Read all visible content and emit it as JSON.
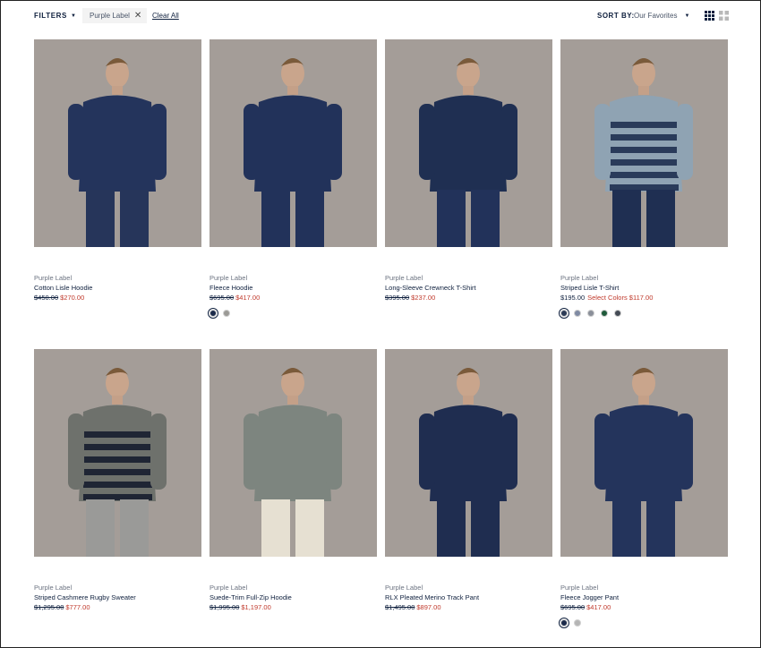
{
  "toolbar": {
    "filters_label": "FILTERS",
    "active_filter": "Purple Label",
    "clear_all": "Clear All",
    "sort_label": "SORT BY:",
    "sort_value": "Our Favorites"
  },
  "colors": {
    "navy": "#0e1f3d",
    "sale_red": "#c0392b",
    "photo_bg": "#a49d98"
  },
  "products": [
    {
      "brand": "Purple Label",
      "name": "Cotton Lisle Hoodie",
      "original_price": "$450.00",
      "sale_price": "$270.00",
      "swatches": []
    },
    {
      "brand": "Purple Label",
      "name": "Fleece Hoodie",
      "original_price": "$695.00",
      "sale_price": "$417.00",
      "swatches": [
        "#1b2a4a",
        "#9b9a96"
      ]
    },
    {
      "brand": "Purple Label",
      "name": "Long-Sleeve Crewneck T-Shirt",
      "original_price": "$395.00",
      "sale_price": "$237.00",
      "swatches": []
    },
    {
      "brand": "Purple Label",
      "name": "Striped Lisle T-Shirt",
      "price": "$195.00",
      "sale_price": "Select Colors $117.00",
      "swatches": [
        "#2b3a55",
        "#7f8aa3",
        "#8a8f99",
        "#1f5a3a",
        "#444b55"
      ]
    },
    {
      "brand": "Purple Label",
      "name": "Striped Cashmere Rugby Sweater",
      "original_price": "$1,295.00",
      "sale_price": "$777.00",
      "swatches": []
    },
    {
      "brand": "Purple Label",
      "name": "Suede-Trim Full-Zip Hoodie",
      "original_price": "$1,995.00",
      "sale_price": "$1,197.00",
      "swatches": []
    },
    {
      "brand": "Purple Label",
      "name": "RLX Pleated Merino Track Pant",
      "original_price": "$1,495.00",
      "sale_price": "$897.00",
      "swatches": []
    },
    {
      "brand": "Purple Label",
      "name": "Fleece Jogger Pant",
      "original_price": "$695.00",
      "sale_price": "$417.00",
      "swatches": [
        "#1b2a4a",
        "#b5b5b5"
      ]
    }
  ]
}
